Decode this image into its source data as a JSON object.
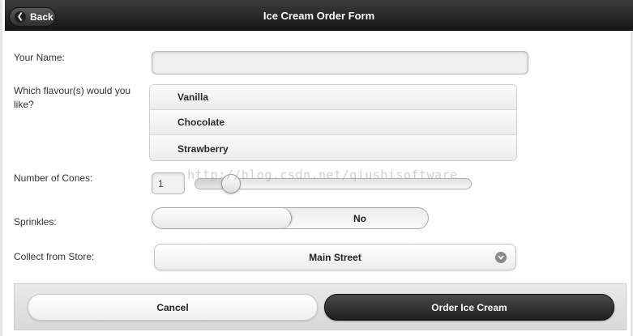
{
  "header": {
    "back_label": "Back",
    "title": "Ice Cream Order Form"
  },
  "form": {
    "name": {
      "label": "Your Name:",
      "value": ""
    },
    "flavours": {
      "label": "Which flavour(s) would you like?",
      "options": [
        "Vanilla",
        "Chocolate",
        "Strawberry"
      ]
    },
    "cones": {
      "label": "Number of Cones:",
      "value": "1",
      "slider_fraction": 0.1
    },
    "sprinkles": {
      "label": "Sprinkles:",
      "value": "No"
    },
    "store": {
      "label": "Collect from Store:",
      "selected": "Main Street"
    }
  },
  "footer": {
    "cancel_label": "Cancel",
    "order_label": "Order Ice Cream"
  },
  "watermark": "http://blog.csdn.net/qiushisoftware",
  "icons": {
    "back": "left-arrow-icon",
    "select": "chevron-down-icon"
  }
}
